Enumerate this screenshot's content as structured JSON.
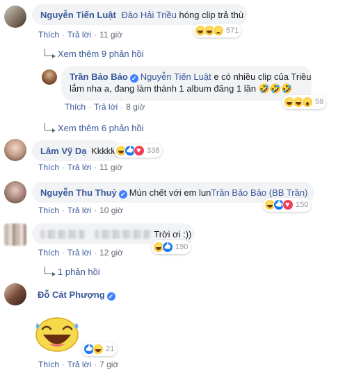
{
  "comments": [
    {
      "author": "Nguyễn Tiến Luật",
      "mention": "Đào Hải Triều",
      "text": " hóng clip trả thù",
      "actions": {
        "like": "Thích",
        "reply": "Trả lời",
        "time": "11 giờ"
      },
      "reactions": [
        "haha",
        "haha",
        "sad"
      ],
      "reaction_count": "571"
    },
    {
      "see_more": "Xem thêm 9 phản hồi"
    },
    {
      "author": "Trần Bảo Bảo",
      "mention": "Nguyễn Tiến Luật",
      "text_line1": " e có nhiều clip của Triều",
      "text_line2": "lắm nha a, đang làm thành 1 album đăng 1 lần 🤣🤣🤣",
      "actions": {
        "like": "Thích",
        "reply": "Trả lời",
        "time": "8 giờ"
      },
      "reactions": [
        "haha",
        "haha",
        "wow"
      ],
      "reaction_count": "59"
    },
    {
      "see_more": "Xem thêm 6 phản hồi"
    },
    {
      "author": "Lâm Vỹ Dạ",
      "text": "Kkkkk",
      "actions": {
        "like": "Thích",
        "reply": "Trả lời",
        "time": "11 giờ"
      },
      "reactions": [
        "haha",
        "like",
        "love"
      ],
      "reaction_count": "338"
    },
    {
      "author": "Nguyễn Thu Thuỷ",
      "text": "Mún chết với em lun",
      "mention": "Trần Bảo Bảo (BB Trần)",
      "actions": {
        "like": "Thích",
        "reply": "Trả lời",
        "time": "10 giờ"
      },
      "reactions": [
        "haha",
        "like",
        "love"
      ],
      "reaction_count": "150"
    },
    {
      "text": "Trời ơi :))",
      "actions": {
        "like": "Thích",
        "reply": "Trả lời",
        "time": "12 giờ"
      },
      "reactions": [
        "haha",
        "like"
      ],
      "reaction_count": "190"
    },
    {
      "see_more": "1 phản hồi"
    },
    {
      "author": "Đỗ Cát Phượng",
      "actions": {
        "like": "Thích",
        "reply": "Trả lời",
        "time": "7 giờ"
      },
      "reactions": [
        "like",
        "haha"
      ],
      "reaction_count": "21"
    }
  ]
}
